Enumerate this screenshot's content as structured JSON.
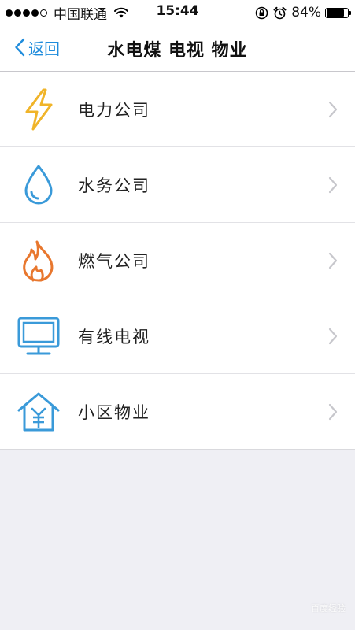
{
  "status_bar": {
    "carrier": "中国联通",
    "time": "15:44",
    "battery_percent": "84%",
    "battery_level": 0.84,
    "signal_bars_filled": 4,
    "signal_bars_total": 5
  },
  "nav": {
    "back_label": "返回",
    "title": "水电煤 电视 物业"
  },
  "list": {
    "items": [
      {
        "label": "电力公司",
        "icon": "lightning-icon",
        "color": "#f0b429"
      },
      {
        "label": "水务公司",
        "icon": "water-drop-icon",
        "color": "#3a9ad9"
      },
      {
        "label": "燃气公司",
        "icon": "flame-icon",
        "color": "#e8772e"
      },
      {
        "label": "有线电视",
        "icon": "tv-monitor-icon",
        "color": "#3a9ad9"
      },
      {
        "label": "小区物业",
        "icon": "house-yen-icon",
        "color": "#3a9ad9"
      }
    ]
  },
  "colors": {
    "accent": "#1f8cdc",
    "background": "#efeff4",
    "chevron": "#c7c7cc"
  },
  "watermark": {
    "text": "百度经验"
  }
}
